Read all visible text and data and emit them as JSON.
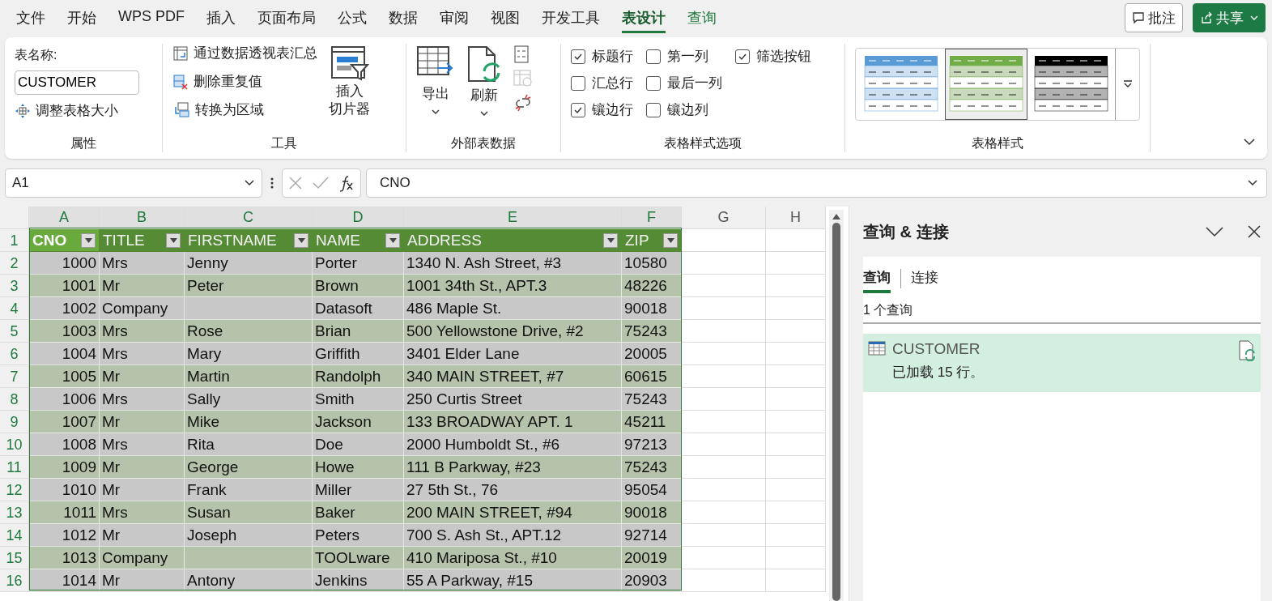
{
  "menu_tabs": [
    {
      "label": "文件",
      "selected": false,
      "kind": "standard"
    },
    {
      "label": "开始",
      "selected": false,
      "kind": "standard"
    },
    {
      "label": "WPS PDF",
      "selected": false,
      "kind": "standard"
    },
    {
      "label": "插入",
      "selected": false,
      "kind": "standard"
    },
    {
      "label": "页面布局",
      "selected": false,
      "kind": "standard"
    },
    {
      "label": "公式",
      "selected": false,
      "kind": "standard"
    },
    {
      "label": "数据",
      "selected": false,
      "kind": "standard"
    },
    {
      "label": "审阅",
      "selected": false,
      "kind": "standard"
    },
    {
      "label": "视图",
      "selected": false,
      "kind": "standard"
    },
    {
      "label": "开发工具",
      "selected": false,
      "kind": "standard"
    },
    {
      "label": "表设计",
      "selected": true,
      "kind": "contextual"
    },
    {
      "label": "查询",
      "selected": false,
      "kind": "contextual"
    }
  ],
  "comment_button": "批注",
  "share_button": "共享",
  "ribbon": {
    "properties": {
      "name_label": "表名称:",
      "table_name": "CUSTOMER",
      "resize": "调整表格大小",
      "group": "属性"
    },
    "tools": {
      "pivot": "通过数据透视表汇总",
      "remove_duplicates": "删除重复值",
      "convert": "转换为区域",
      "slicer": [
        "插入",
        "切片器"
      ],
      "group": "工具"
    },
    "external": {
      "export": "导出",
      "refresh": "刷新",
      "group": "外部表数据"
    },
    "style_options": {
      "option_rows": [
        [
          {
            "label": "标题行",
            "checked": true
          },
          {
            "label": "第一列",
            "checked": false
          },
          {
            "label": "筛选按钮",
            "checked": true
          }
        ],
        [
          {
            "label": "汇总行",
            "checked": false
          },
          {
            "label": "最后一列",
            "checked": false
          }
        ],
        [
          {
            "label": "镶边行",
            "checked": true
          },
          {
            "label": "镶边列",
            "checked": false
          }
        ]
      ],
      "group": "表格样式选项"
    },
    "styles": {
      "items": [
        {
          "selected": false,
          "color": "#5b9bd5"
        },
        {
          "selected": true,
          "color": "#70ad47"
        },
        {
          "selected": false,
          "color": "#000000"
        }
      ],
      "group": "表格样式"
    }
  },
  "name_box": "A1",
  "formula": "CNO",
  "columns": [
    {
      "label": "A",
      "selected": true
    },
    {
      "label": "B",
      "selected": true
    },
    {
      "label": "C",
      "selected": true
    },
    {
      "label": "D",
      "selected": true
    },
    {
      "label": "E",
      "selected": true
    },
    {
      "label": "F",
      "selected": true
    },
    {
      "label": "G",
      "selected": false
    },
    {
      "label": "H",
      "selected": false
    }
  ],
  "table_headers": [
    "CNO",
    "TITLE",
    "FIRSTNAME",
    "NAME",
    "ADDRESS",
    "ZIP"
  ],
  "rows": [
    {
      "number": "1"
    },
    {
      "number": "2",
      "cells": [
        "1000",
        "Mrs",
        "Jenny",
        "Porter",
        "1340 N. Ash Street, #3",
        "10580"
      ]
    },
    {
      "number": "3",
      "cells": [
        "1001",
        "Mr",
        "Peter",
        "Brown",
        "1001 34th St., APT.3",
        "48226"
      ]
    },
    {
      "number": "4",
      "cells": [
        "1002",
        "Company",
        null,
        "Datasoft",
        "486 Maple St.",
        "90018"
      ]
    },
    {
      "number": "5",
      "cells": [
        "1003",
        "Mrs",
        "Rose",
        "Brian",
        "500 Yellowstone Drive, #2",
        "75243"
      ]
    },
    {
      "number": "6",
      "cells": [
        "1004",
        "Mrs",
        "Mary",
        "Griffith",
        "3401 Elder Lane",
        "20005"
      ]
    },
    {
      "number": "7",
      "cells": [
        "1005",
        "Mr",
        "Martin",
        "Randolph",
        "340 MAIN STREET, #7",
        "60615"
      ]
    },
    {
      "number": "8",
      "cells": [
        "1006",
        "Mrs",
        "Sally",
        "Smith",
        "250 Curtis Street",
        "75243"
      ]
    },
    {
      "number": "9",
      "cells": [
        "1007",
        "Mr",
        "Mike",
        "Jackson",
        "133 BROADWAY APT. 1",
        "45211"
      ]
    },
    {
      "number": "10",
      "cells": [
        "1008",
        "Mrs",
        "Rita",
        "Doe",
        "2000 Humboldt St., #6",
        "97213"
      ]
    },
    {
      "number": "11",
      "cells": [
        "1009",
        "Mr",
        "George",
        "Howe",
        "111 B Parkway, #23",
        "75243"
      ]
    },
    {
      "number": "12",
      "cells": [
        "1010",
        "Mr",
        "Frank",
        "Miller",
        "27 5th St., 76",
        "95054"
      ]
    },
    {
      "number": "13",
      "cells": [
        "1011",
        "Mrs",
        "Susan",
        "Baker",
        "200 MAIN STREET, #94",
        "90018"
      ]
    },
    {
      "number": "14",
      "cells": [
        "1012",
        "Mr",
        "Joseph",
        "Peters",
        "700 S. Ash St., APT.12",
        "92714"
      ]
    },
    {
      "number": "15",
      "cells": [
        "1013",
        "Company",
        null,
        "TOOLware",
        "410 Mariposa St., #10",
        "20019"
      ]
    },
    {
      "number": "16",
      "cells": [
        "1014",
        "Mr",
        "Antony",
        "Jenkins",
        "55 A Parkway, #15",
        "20903"
      ]
    }
  ],
  "panel": {
    "title": "查询 & 连接",
    "tabs": [
      {
        "label": "查询",
        "selected": true
      },
      {
        "label": "连接",
        "selected": false
      }
    ],
    "count": "1 个查询",
    "queries": [
      {
        "name": "CUSTOMER",
        "status": "已加载 15 行。",
        "selected": true
      }
    ]
  }
}
